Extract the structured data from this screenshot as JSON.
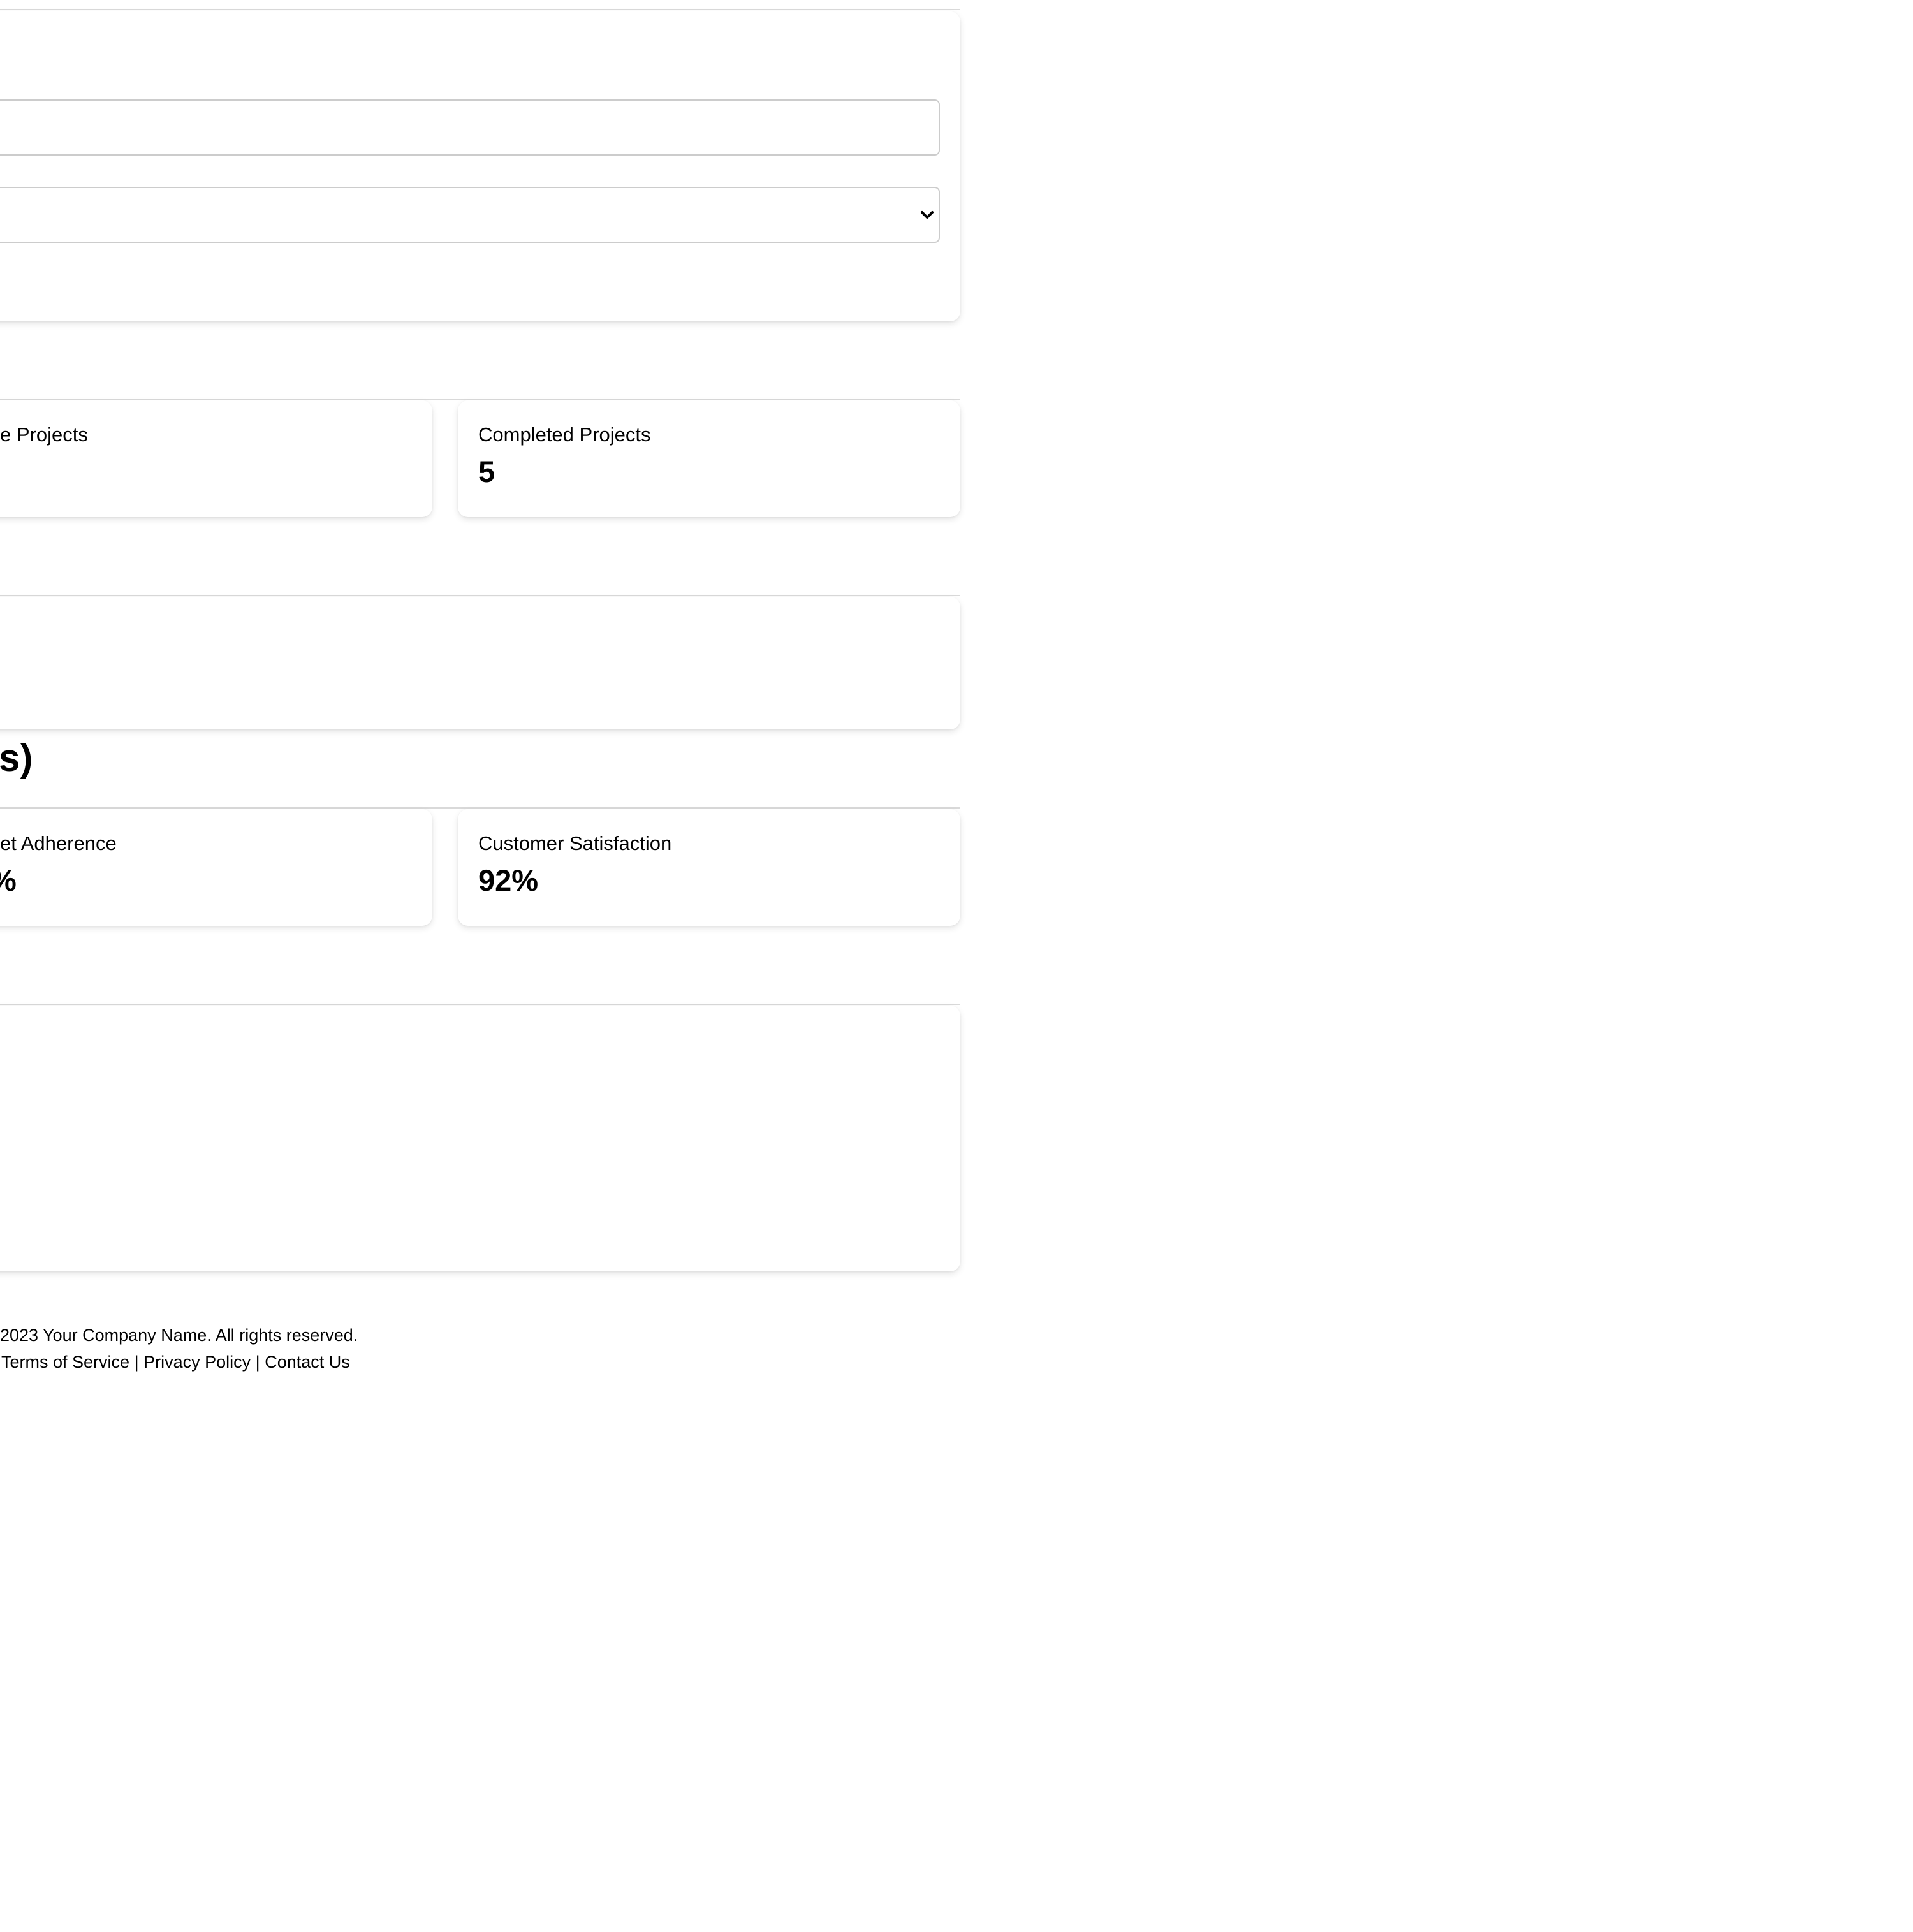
{
  "project_stats": {
    "active_projects_label": "e Projects",
    "completed_projects_label": "Completed Projects",
    "completed_projects_value": "5"
  },
  "performance": {
    "heading": "s)",
    "budget_adherence_label": "et Adherence",
    "budget_adherence_value": "%",
    "customer_satisfaction_label": "Customer Satisfaction",
    "customer_satisfaction_value": "92%"
  },
  "footer": {
    "copyright": " 2023 Your Company Name. All rights reserved.",
    "terms": "Terms of Service",
    "privacy": "Privacy Policy",
    "contact": "Contact Us",
    "separator": "|"
  }
}
